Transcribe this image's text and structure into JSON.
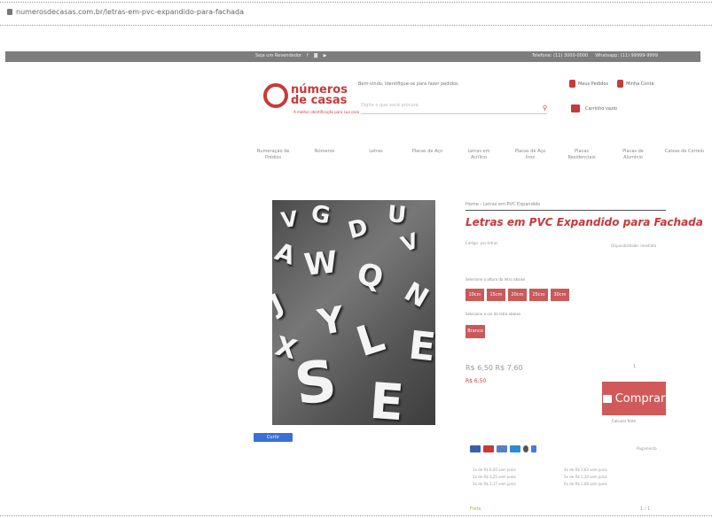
{
  "browser": {
    "url": "numerosdecasas.com.br/letras-em-pvc-expandido-para-fachada"
  },
  "topbar": {
    "left_label": "Seja um Revendedor",
    "right_items": [
      "Telefone: (11) 3000-0000",
      "Whatsapp: (11) 99999-9999"
    ]
  },
  "header": {
    "logo_line1": "números",
    "logo_line2": "de casas",
    "logo_tagline": "A melhor identificação para sua casa",
    "welcome": "Bem-vindo, Identifique-se para fazer pedidos",
    "search_placeholder": "Digite o que você procura",
    "orders": "Meus Pedidos",
    "account": "Minha Conta",
    "cart": "Carrinho vazio"
  },
  "nav": [
    "Numeração de Prédios",
    "Números",
    "Letras",
    "Placas de Aço",
    "Letras em Acrílico",
    "Placas de Aço Inox",
    "Placas Residenciais",
    "Placas de Alumínio",
    "Caixas de Correio"
  ],
  "product": {
    "breadcrumb": "Home › Letras em PVC Expandido",
    "title": "Letras em PVC Expandido para Fachada",
    "ref": "Código: pvc-letras",
    "availability": "Disponibilidade: Imediata",
    "size_label": "Selecione a altura da letra abaixo",
    "sizes": [
      "10cm",
      "15cm",
      "20cm",
      "25cm",
      "30cm"
    ],
    "color_label": "Selecione a cor da letra abaixo",
    "color": "Branco",
    "price_from": "R$ 6,50 R$ 7,60",
    "price_to": "R$ 6,50",
    "qty_label": "1",
    "buy_label": "Comprar",
    "shipping_link": "Calcular frete",
    "facebook_btn": "Curtir"
  },
  "payment": {
    "right_label": "Pagamento",
    "installments_left": [
      "1x de R$ 6,50 sem juros",
      "2x de R$ 3,25 sem juros",
      "3x de R$ 2,17 sem juros"
    ],
    "installments_right": [
      "4x de R$ 1,63 sem juros",
      "5x de R$ 1,30 sem juros",
      "6x de R$ 1,08 sem juros"
    ]
  },
  "footer": {
    "left": "Frete",
    "right": "1 / 1"
  },
  "colors": {
    "brand": "#c73a3a",
    "topbar": "#7d7d7d",
    "facebook": "#3b6fd6"
  }
}
